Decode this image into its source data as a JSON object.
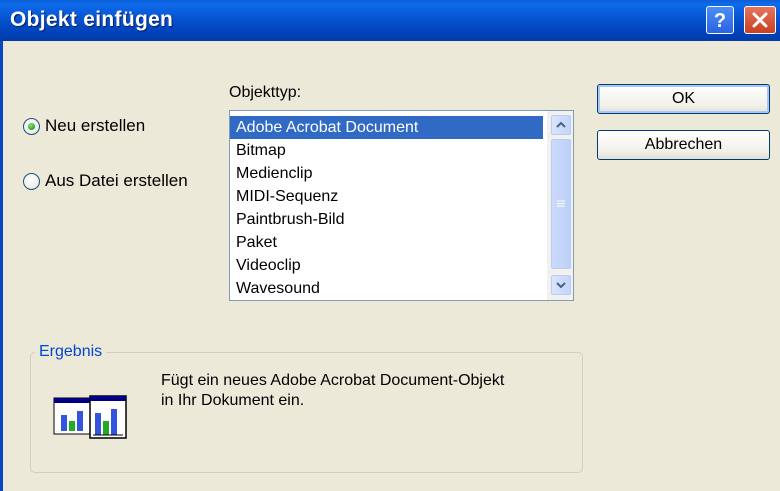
{
  "window": {
    "title": "Objekt einfügen",
    "help_button": "?",
    "close_button": "close"
  },
  "options": {
    "new_label": "Neu erstellen",
    "from_file_label": "Aus Datei erstellen",
    "selected": "Neu erstellen"
  },
  "object_type": {
    "label": "Objekttyp:",
    "items": [
      {
        "label": "Adobe Acrobat Document",
        "selected": true
      },
      {
        "label": "Bitmap"
      },
      {
        "label": "Medienclip"
      },
      {
        "label": "MIDI-Sequenz"
      },
      {
        "label": "Paintbrush-Bild"
      },
      {
        "label": "Paket"
      },
      {
        "label": "Videoclip"
      },
      {
        "label": "Wavesound"
      }
    ]
  },
  "buttons": {
    "ok": "OK",
    "cancel": "Abbrechen"
  },
  "result": {
    "legend": "Ergebnis",
    "line1": "Fügt ein neues Adobe Acrobat Document-Objekt",
    "line2": "in Ihr Dokument ein.",
    "icon": "object-icon"
  },
  "colors": {
    "titlebar": "#0054E3",
    "selection": "#316AC5",
    "dialog_bg": "#ECE9D8",
    "group_legend": "#0046D5"
  }
}
